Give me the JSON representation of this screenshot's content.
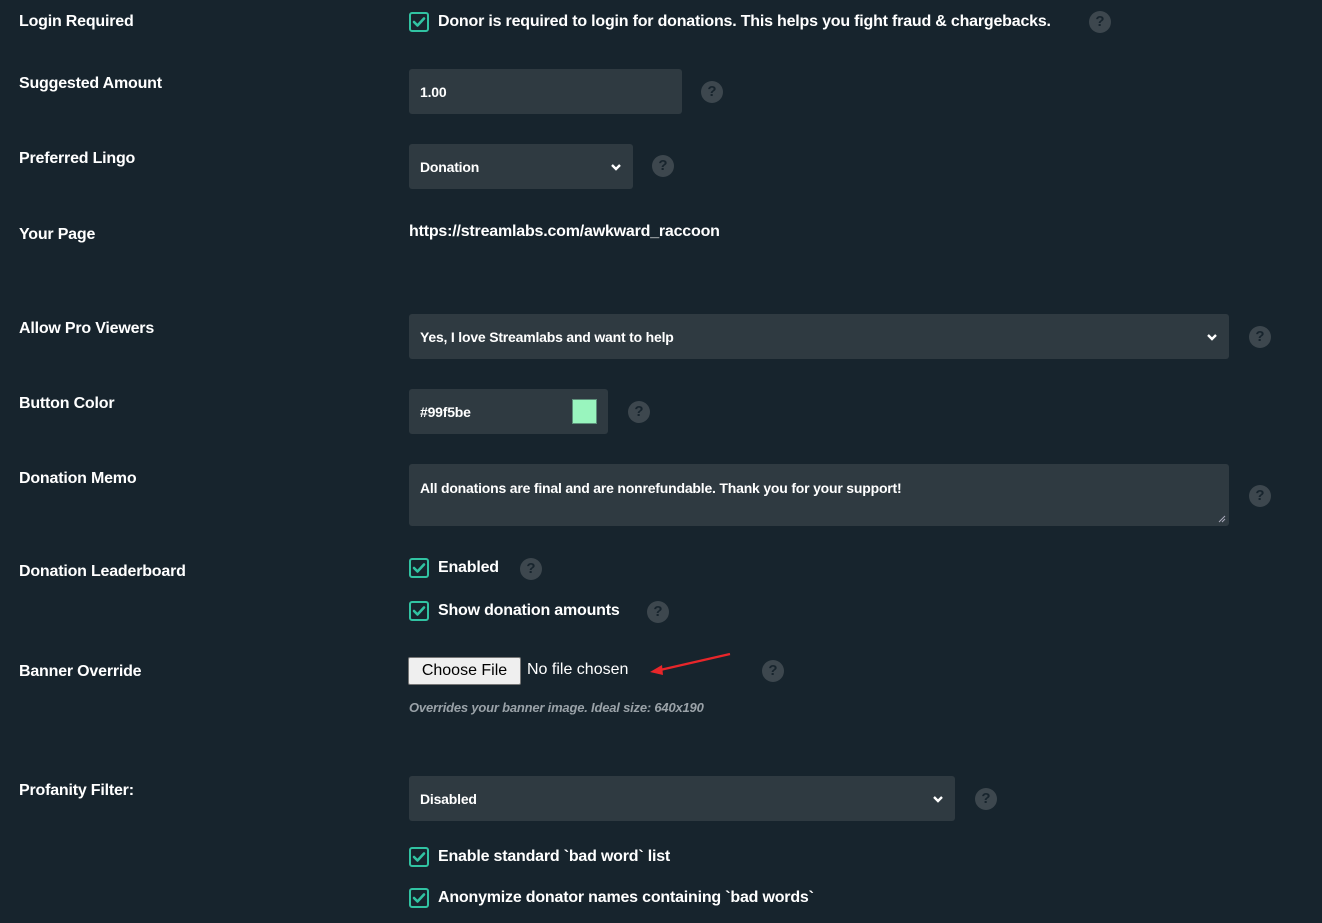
{
  "settings": {
    "login_required": {
      "label": "Login Required",
      "checkbox_label": "Donor is required to login for donations. This helps you fight fraud & chargebacks.",
      "checked": true,
      "help_icon": "question-circle-icon"
    },
    "suggested_amount": {
      "label": "Suggested Amount",
      "value": "1.00",
      "help_icon": "question-circle-icon"
    },
    "preferred_lingo": {
      "label": "Preferred Lingo",
      "selected": "Donation",
      "help_icon": "question-circle-icon"
    },
    "your_page": {
      "label": "Your Page",
      "url": "https://streamlabs.com/awkward_raccoon"
    },
    "allow_pro_viewers": {
      "label": "Allow Pro Viewers",
      "selected": "Yes, I love Streamlabs and want to help",
      "help_icon": "question-circle-icon"
    },
    "button_color": {
      "label": "Button Color",
      "value": "#99f5be",
      "swatch_color": "#99f5be",
      "help_icon": "question-circle-icon"
    },
    "donation_memo": {
      "label": "Donation Memo",
      "value": "All donations are final and are nonrefundable. Thank you for your support!",
      "help_icon": "question-circle-icon"
    },
    "donation_leaderboard": {
      "label": "Donation Leaderboard",
      "options": [
        {
          "label": "Enabled",
          "checked": true
        },
        {
          "label": "Show donation amounts",
          "checked": true
        }
      ]
    },
    "banner_override": {
      "label": "Banner Override",
      "button_label": "Choose File",
      "file_status": "No file chosen",
      "hint": "Overrides your banner image. Ideal size: 640x190",
      "annotation": "red-arrow-icon"
    },
    "profanity_filter": {
      "label": "Profanity Filter:",
      "selected": "Disabled",
      "options": [
        {
          "label": "Enable standard `bad word` list",
          "checked": true
        },
        {
          "label": "Anonymize donator names containing `bad words`",
          "checked": true
        }
      ]
    }
  },
  "theme": {
    "background": "#17242d",
    "field_background": "#2f3a41",
    "accent": "#31c3a2",
    "help_icon_bg": "#3d474e",
    "annotation_color": "#e8262a"
  }
}
